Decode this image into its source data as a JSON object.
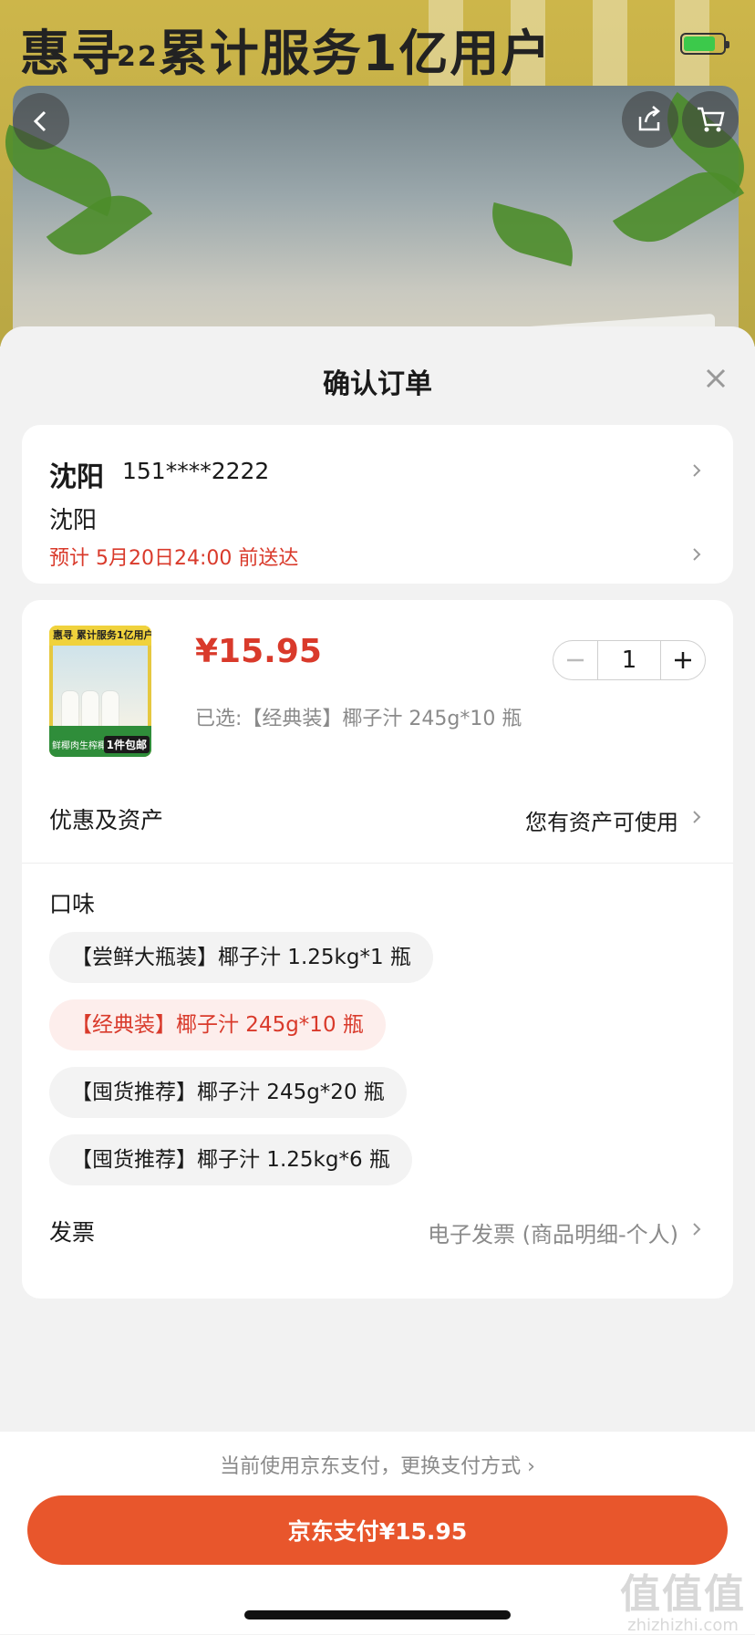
{
  "background_page": {
    "banner_brand": "惠寻",
    "banner_number": "22",
    "banner_slogan": "累计服务1亿用户"
  },
  "sheet": {
    "title": "确认订单"
  },
  "address": {
    "city": "沈阳",
    "phone": "151****2222",
    "detail": "沈阳",
    "eta": "预计 5月20日24:00 前送达"
  },
  "product": {
    "price": "¥15.95",
    "quantity": "1",
    "selected_spec": "已选:【经典装】椰子汁 245g*10 瓶",
    "thumb_brand": "惠寻",
    "thumb_slogan": "累计服务1亿用户",
    "thumb_caption": "鲜椰肉生榨椰汁",
    "thumb_tag": "1件包邮"
  },
  "benefits": {
    "label": "优惠及资产",
    "value": "您有资产可使用"
  },
  "flavor": {
    "label": "口味",
    "options": [
      "【尝鲜大瓶装】椰子汁 1.25kg*1 瓶",
      "【经典装】椰子汁 245g*10 瓶",
      "【囤货推荐】椰子汁 245g*20 瓶",
      "【囤货推荐】椰子汁 1.25kg*6 瓶"
    ],
    "selected_index": 1
  },
  "invoice": {
    "label": "发票",
    "value": "电子发票 (商品明细-个人)"
  },
  "footer": {
    "payment_switch": "当前使用京东支付，更换支付方式 ›",
    "pay_button": "京东支付¥15.95"
  },
  "watermark": {
    "big": "值值值",
    "small": "zhizhizhi.com"
  },
  "colors": {
    "accent": "#e8562c",
    "price_red": "#d93a2b",
    "background": "#f2f2f2"
  }
}
